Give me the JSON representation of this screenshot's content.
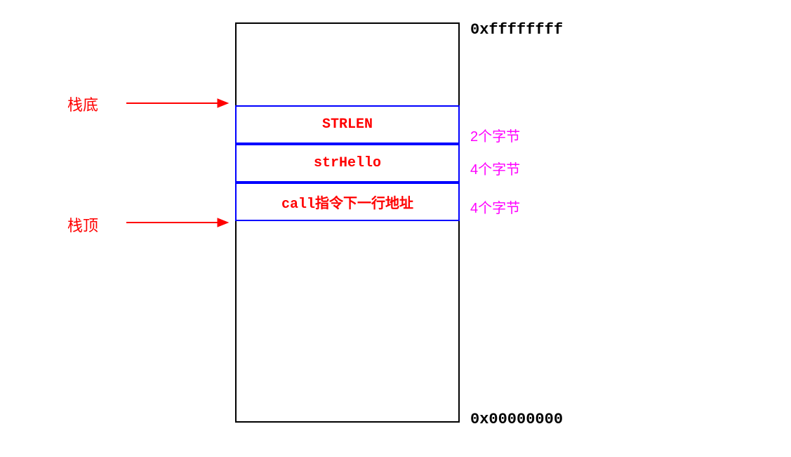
{
  "addresses": {
    "high": "0xffffffff",
    "low": "0x00000000"
  },
  "pointers": {
    "stack_bottom": "栈底",
    "stack_top": "栈顶"
  },
  "stack": {
    "row1": {
      "label": "STRLEN",
      "size": "2个字节"
    },
    "row2": {
      "label": "strHello",
      "size": "4个字节"
    },
    "row3": {
      "label": "call指令下一行地址",
      "size": "4个字节"
    }
  }
}
